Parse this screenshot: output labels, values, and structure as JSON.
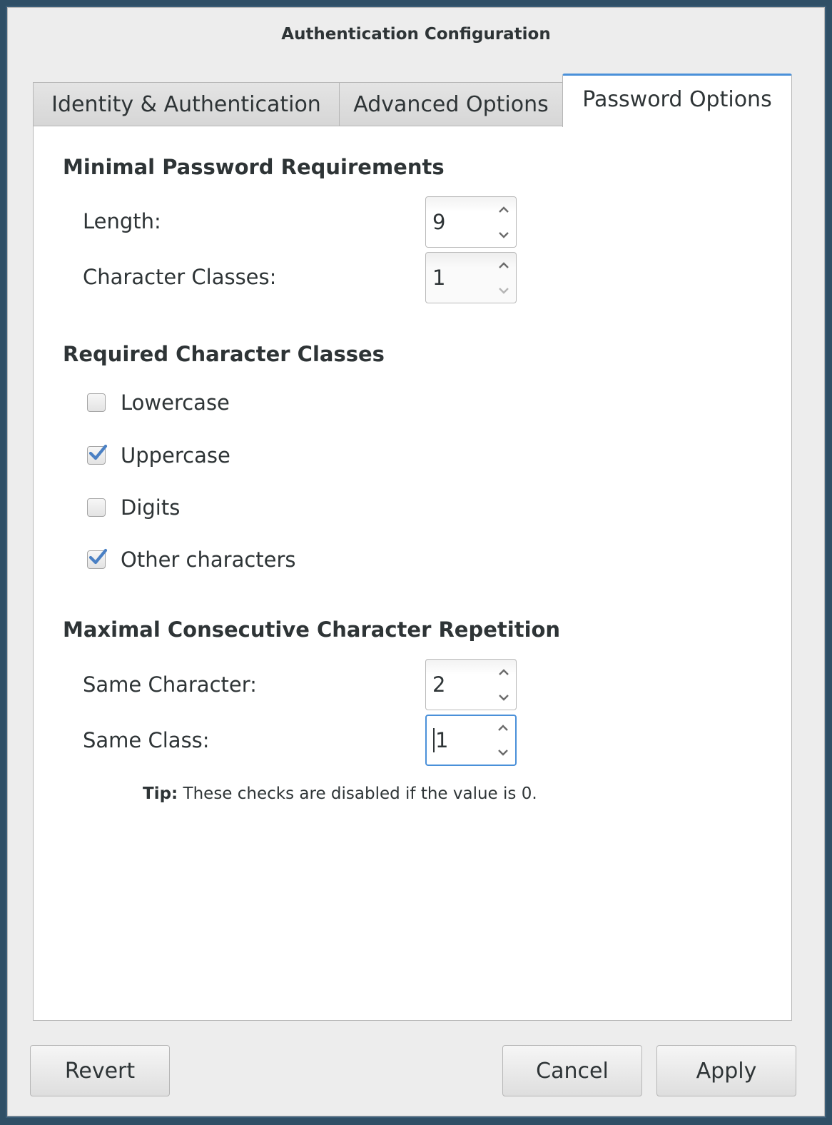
{
  "window": {
    "title": "Authentication Configuration"
  },
  "tabs": [
    {
      "label": "Identity & Authentication",
      "active": false
    },
    {
      "label": "Advanced Options",
      "active": false
    },
    {
      "label": "Password Options",
      "active": true
    }
  ],
  "minimal_requirements": {
    "heading": "Minimal Password Requirements",
    "length": {
      "label": "Length:",
      "value": "9"
    },
    "character_classes": {
      "label": "Character Classes:",
      "value": "1"
    }
  },
  "required_classes": {
    "heading": "Required Character Classes",
    "items": [
      {
        "label": "Lowercase",
        "checked": false
      },
      {
        "label": "Uppercase",
        "checked": true
      },
      {
        "label": "Digits",
        "checked": false
      },
      {
        "label": "Other characters",
        "checked": true
      }
    ]
  },
  "repetition": {
    "heading": "Maximal Consecutive Character Repetition",
    "same_character": {
      "label": "Same Character:",
      "value": "2"
    },
    "same_class": {
      "label": "Same Class:",
      "value": "1"
    }
  },
  "tip": {
    "prefix": "Tip:",
    "text": " These checks are disabled if the value is 0."
  },
  "buttons": {
    "revert": "Revert",
    "cancel": "Cancel",
    "apply": "Apply"
  },
  "colors": {
    "accent": "#4a90d9",
    "text": "#2e3436",
    "background": "#ededed",
    "panel": "#ffffff"
  },
  "icons": {
    "spin_up": "chevron-up-icon",
    "spin_down": "chevron-down-icon",
    "check": "checkmark-icon"
  }
}
